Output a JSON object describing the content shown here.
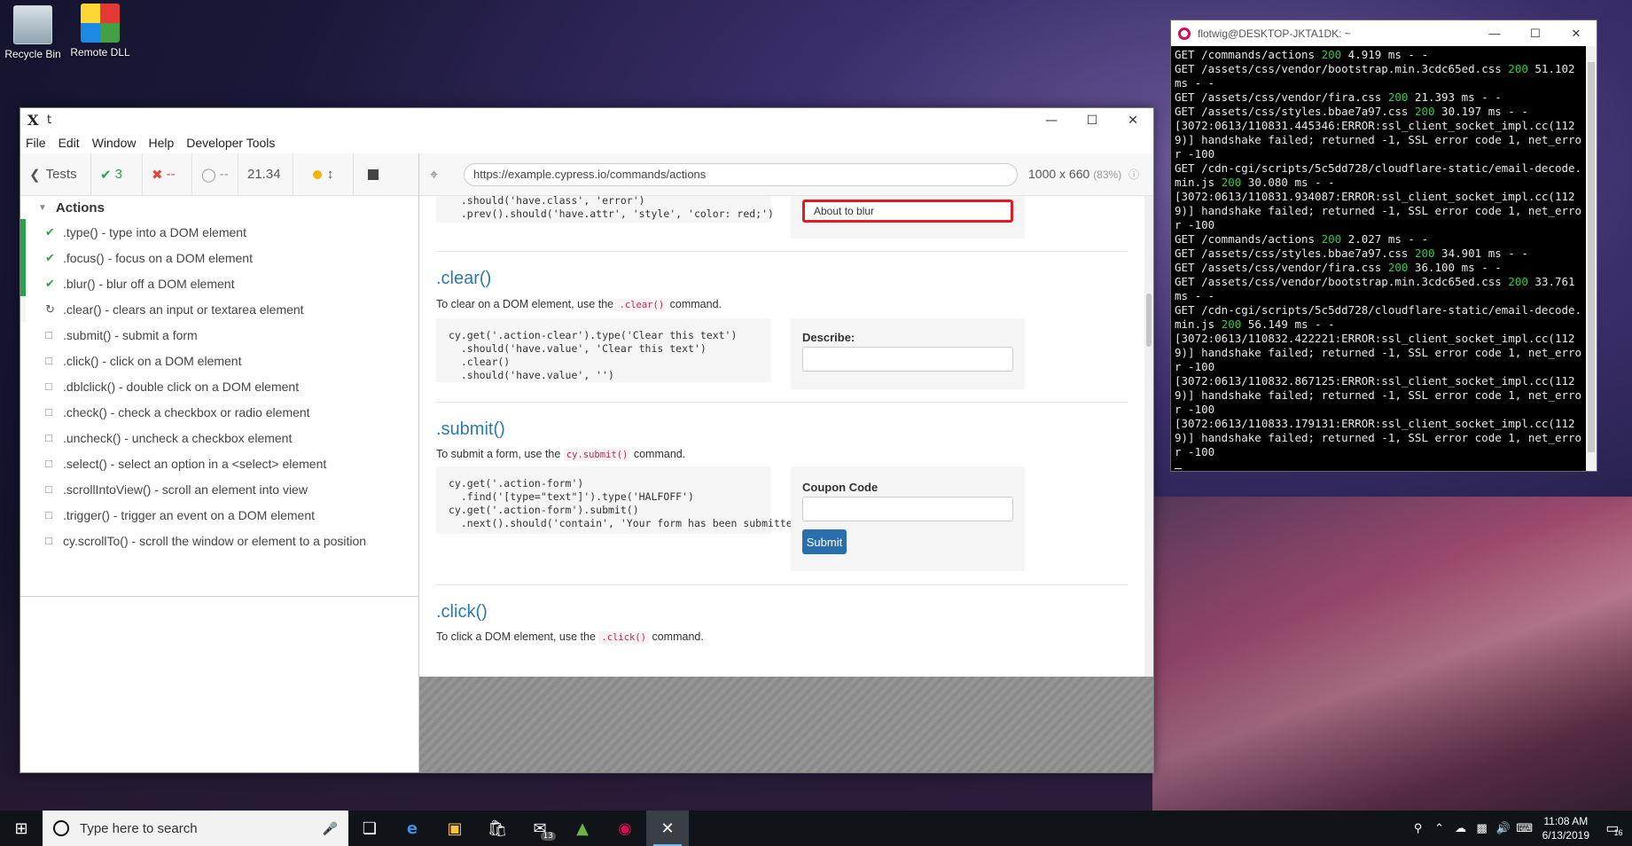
{
  "desktop": {
    "icons": [
      {
        "label": "Recycle Bin"
      },
      {
        "label": "Remote DLL"
      }
    ]
  },
  "cypress": {
    "window_title": "t",
    "app_logo": "X",
    "menu": [
      "File",
      "Edit",
      "Window",
      "Help",
      "Developer Tools"
    ],
    "stats": {
      "tests_label": "Tests",
      "passed": "3",
      "failed": "--",
      "pending": "--",
      "duration": "21.34"
    },
    "suite_title": "Actions",
    "tests": [
      {
        "label": ".type() - type into a DOM element",
        "state": "passed"
      },
      {
        "label": ".focus() - focus on a DOM element",
        "state": "passed"
      },
      {
        "label": ".blur() - blur off a DOM element",
        "state": "passed"
      },
      {
        "label": ".clear() - clears an input or textarea element",
        "state": "running"
      },
      {
        "label": ".submit() - submit a form",
        "state": "pending"
      },
      {
        "label": ".click() - click on a DOM element",
        "state": "pending"
      },
      {
        "label": ".dblclick() - double click on a DOM element",
        "state": "pending"
      },
      {
        "label": ".check() - check a checkbox or radio element",
        "state": "pending"
      },
      {
        "label": ".uncheck() - uncheck a checkbox element",
        "state": "pending"
      },
      {
        "label": ".select() - select an option in a <select> element",
        "state": "pending"
      },
      {
        "label": ".scrollIntoView() - scroll an element into view",
        "state": "pending"
      },
      {
        "label": ".trigger() - trigger an event on a DOM element",
        "state": "pending"
      },
      {
        "label": "cy.scrollTo() - scroll the window or element to a position",
        "state": "pending"
      }
    ],
    "url": "https://example.cypress.io/commands/actions",
    "viewport": "1000 x 660",
    "viewport_scale": "(83%)",
    "aut": {
      "blur_code_line1": "  .should('have.class', 'error')",
      "blur_code_line2": "  .prev().should('have.attr', 'style', 'color: red;')",
      "blur_input_value": "About to blur",
      "clear_title": ".clear()",
      "clear_desc_pre": "To clear on a DOM element, use the",
      "clear_desc_code": ".clear()",
      "clear_desc_post": "command.",
      "clear_code": [
        "cy.get('.action-clear').type('Clear this text')",
        "  .should('have.value', 'Clear this text')",
        "  .clear()",
        "  .should('have.value', '')"
      ],
      "clear_label": "Describe:",
      "submit_title": ".submit()",
      "submit_desc_pre": "To submit a form, use the",
      "submit_desc_code": "cy.submit()",
      "submit_desc_post": "command.",
      "submit_code": [
        "cy.get('.action-form')",
        "  .find('[type=\"text\"]').type('HALFOFF')",
        "cy.get('.action-form').submit()",
        "  .next().should('contain', 'Your form has been submitted!')"
      ],
      "submit_label": "Coupon Code",
      "submit_button": "Submit",
      "click_title": ".click()",
      "click_desc_pre": "To click a DOM element, use the",
      "click_desc_code": ".click()",
      "click_desc_post": "command."
    }
  },
  "terminal": {
    "title": "flotwig@DESKTOP-JKTA1DK: ~",
    "lines": [
      {
        "pre": "GET /commands/actions ",
        "code": "200",
        "post": " 4.919 ms - -"
      },
      {
        "pre": "GET /assets/css/vendor/bootstrap.min.3cdc65ed.css ",
        "code": "200",
        "post": " 51.102 ms - -"
      },
      {
        "pre": "GET /assets/css/vendor/fira.css ",
        "code": "200",
        "post": " 21.393 ms - -"
      },
      {
        "pre": "GET /assets/css/styles.bbae7a97.css ",
        "code": "200",
        "post": " 30.197 ms - -"
      },
      {
        "pre": "[3072:0613/110831.445346:ERROR:ssl_client_socket_impl.cc(1129)] handshake failed; returned -1, SSL error code 1, net_error -100",
        "code": "",
        "post": ""
      },
      {
        "pre": "GET /cdn-cgi/scripts/5c5dd728/cloudflare-static/email-decode.min.js ",
        "code": "200",
        "post": " 30.080 ms - -"
      },
      {
        "pre": "[3072:0613/110831.934087:ERROR:ssl_client_socket_impl.cc(1129)] handshake failed; returned -1, SSL error code 1, net_error -100",
        "code": "",
        "post": ""
      },
      {
        "pre": "GET /commands/actions ",
        "code": "200",
        "post": " 2.027 ms - -"
      },
      {
        "pre": "GET /assets/css/styles.bbae7a97.css ",
        "code": "200",
        "post": " 34.901 ms - -"
      },
      {
        "pre": "GET /assets/css/vendor/fira.css ",
        "code": "200",
        "post": " 36.100 ms - -"
      },
      {
        "pre": "GET /assets/css/vendor/bootstrap.min.3cdc65ed.css ",
        "code": "200",
        "post": " 33.761 ms - -"
      },
      {
        "pre": "GET /cdn-cgi/scripts/5c5dd728/cloudflare-static/email-decode.min.js ",
        "code": "200",
        "post": " 56.149 ms - -"
      },
      {
        "pre": "[3072:0613/110832.422221:ERROR:ssl_client_socket_impl.cc(1129)] handshake failed; returned -1, SSL error code 1, net_error -100",
        "code": "",
        "post": ""
      },
      {
        "pre": "[3072:0613/110832.867125:ERROR:ssl_client_socket_impl.cc(1129)] handshake failed; returned -1, SSL error code 1, net_error -100",
        "code": "",
        "post": ""
      },
      {
        "pre": "[3072:0613/110833.179131:ERROR:ssl_client_socket_impl.cc(1129)] handshake failed; returned -1, SSL error code 1, net_error -100",
        "code": "",
        "post": ""
      }
    ]
  },
  "taskbar": {
    "search_placeholder": "Type here to search",
    "mail_badge": "13",
    "time": "11:08 AM",
    "date": "6/13/2019",
    "notif_count": "16"
  },
  "colors": {
    "pass": "#2ba14b",
    "fail": "#e0443c",
    "link": "#2a7ab0",
    "primary_button": "#2a6fad",
    "terminal_200": "#2ecc40"
  }
}
